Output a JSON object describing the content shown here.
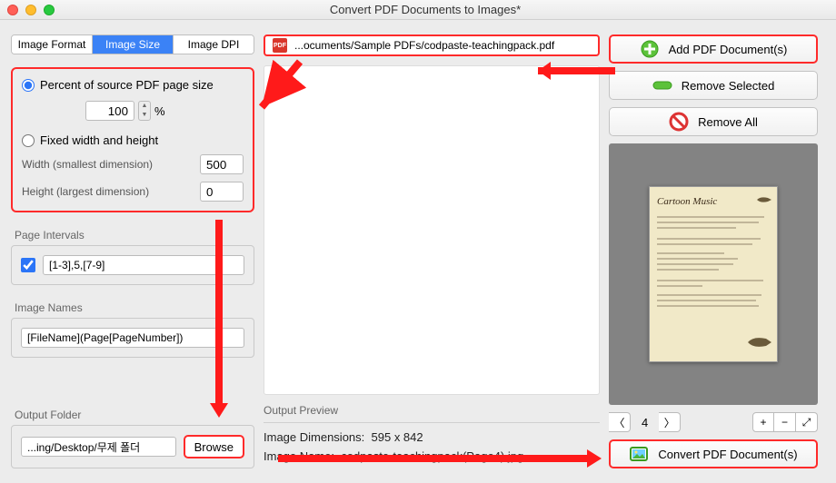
{
  "window": {
    "title": "Convert PDF Documents to Images*"
  },
  "tabs": {
    "format": "Image Format",
    "size": "Image Size",
    "dpi": "Image DPI"
  },
  "size_panel": {
    "percent_label": "Percent of source PDF page size",
    "percent_value": "100",
    "percent_unit": "%",
    "fixed_label": "Fixed width and height",
    "width_label": "Width (smallest dimension)",
    "width_value": "500",
    "height_label": "Height (largest dimension)",
    "height_value": "0"
  },
  "intervals": {
    "label": "Page Intervals",
    "value": "[1-3],5,[7-9]"
  },
  "names": {
    "label": "Image Names",
    "value": "[FileName](Page[PageNumber])"
  },
  "output": {
    "label": "Output Folder",
    "path": "...ing/Desktop/무제 폴더",
    "browse": "Browse"
  },
  "filelist": {
    "path": "...ocuments/Sample PDFs/codpaste-teachingpack.pdf"
  },
  "preview": {
    "label": "Output Preview",
    "dim_label": "Image Dimensions:",
    "dim_value": "595 x 842",
    "name_label": "Image Name:",
    "name_value": "codpaste-teachingpack(Page4).jpg"
  },
  "actions": {
    "add": "Add PDF Document(s)",
    "remove_sel": "Remove Selected",
    "remove_all": "Remove All",
    "convert": "Convert PDF Document(s)"
  },
  "thumb": {
    "title": "Cartoon Music"
  },
  "pager": {
    "page": "4"
  }
}
